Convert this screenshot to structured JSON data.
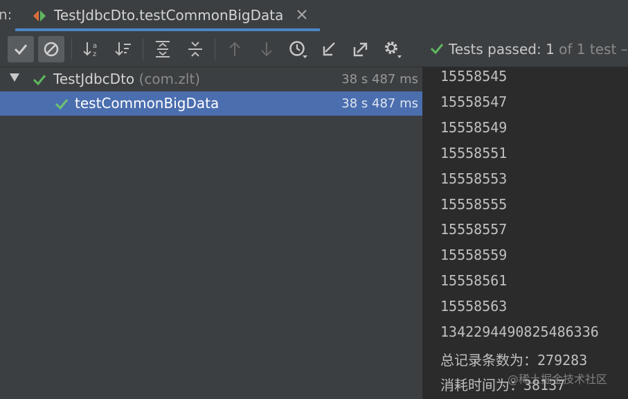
{
  "tabbar": {
    "prefix": "n:",
    "tab_title": "TestJdbcDto.testCommonBigData"
  },
  "toolbar": {
    "status_label": "Tests passed:",
    "status_count": "1",
    "status_rest": "of 1 test –"
  },
  "tree": {
    "rows": [
      {
        "label": "TestJdbcDto",
        "pkg": "(com.zlt)",
        "time": "38 s 487 ms"
      },
      {
        "label": "testCommonBigData",
        "time": "38 s 487 ms"
      }
    ]
  },
  "console": {
    "lines": [
      "15558545",
      "15558547",
      "15558549",
      "15558551",
      "15558553",
      "15558555",
      "15558557",
      "15558559",
      "15558561",
      "15558563",
      "1342294490825486336",
      "总记录条数为：279283",
      "消耗时间为：38137"
    ]
  },
  "watermark": "@稀土掘金技术社区",
  "colors": {
    "pass_green": "#5fb85f",
    "selection": "#4b6eaf",
    "tab_underline": "#4a88c7"
  }
}
